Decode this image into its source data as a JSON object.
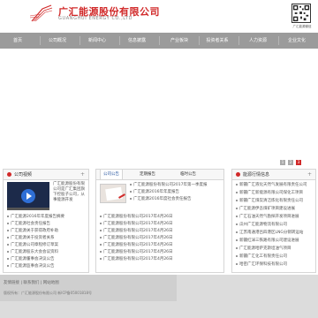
{
  "header": {
    "company_cn": "广汇能源股份有限公司",
    "company_en": "GUANGHUI  ENERGY  CO.,LTD",
    "qr_caption": "广汇能源微信"
  },
  "nav": {
    "items": [
      "首页",
      "公司概况",
      "新闻中心",
      "信息披露",
      "产业板块",
      "投资者关系",
      "人力资源",
      "企业文化"
    ]
  },
  "banner": {
    "slides": [
      "1",
      "2",
      "3"
    ]
  },
  "panel_left": {
    "title": "公司视频",
    "more": "+",
    "intro": "广汇能源股份有限公司是广汇集团旗下控股子公司，从事能源开发",
    "items": [
      "广汇能源2016年年度报告摘要",
      "广汇能源社会责任报告",
      "广汇能源关于获得政府补助",
      "广汇能源关于投资者关系",
      "广汇能源公司章程修订草案",
      "广汇能源股东大会会议资料",
      "广汇能源董事会决议公告",
      "广汇能源监事会决议公告"
    ]
  },
  "panel_mid": {
    "tabs": [
      "公司公告",
      "定期报告",
      "临时公告"
    ],
    "top_items": [
      "广汇能源股份有限公司2017年第一季度报",
      "广汇能源2016年年度报告",
      "广汇能源2016年度社会责任报告"
    ],
    "items": [
      "广汇能源股份有限公司2017年4月26日",
      "广汇能源股份有限公司2017年4月26日",
      "广汇能源股份有限公司2017年4月26日",
      "广汇能源股份有限公司2017年4月26日",
      "广汇能源股份有限公司2017年4月26日",
      "广汇能源股份有限公司2017年4月26日",
      "广汇能源股份有限公司2017年4月26日"
    ]
  },
  "panel_right": {
    "title": "能源行情信息",
    "more": "+",
    "items": [
      "新疆广汇液化天然气发展有限责任公司",
      "新疆广汇新能源有限公司煤化工项目",
      "新疆广汇煤炭清洁炼化有限责任公司",
      "广汇能源伊吾煤矿项目建设进展",
      "广汇石油天然气勘探开发项目进展",
      "瓜州广汇能源物流有限公司",
      "江苏南通港吕四港区LNG分销转运站",
      "新疆红淖三铁路有限公司建设进展",
      "广汇能源哈萨克斯坦油气项目",
      "新疆广汇化工有限责任公司",
      "哈密广汇环保科技有限公司"
    ]
  },
  "footer": {
    "links": [
      "友情链接",
      "联系我们",
      "网站地图"
    ],
    "copyright": "版权所有：广汇能源股份有限公司  新ICP备05001818号"
  }
}
